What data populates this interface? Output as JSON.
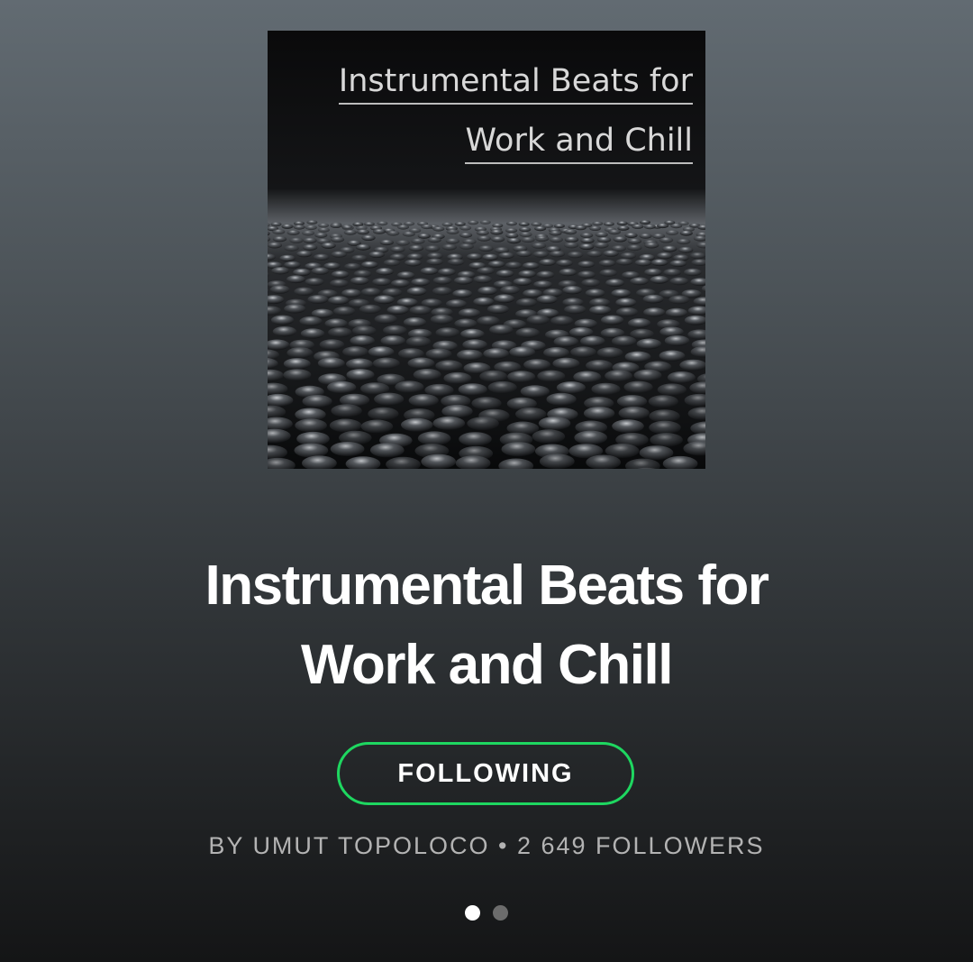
{
  "cover": {
    "line1": "Instrumental Beats for",
    "line2": "Work and Chill"
  },
  "playlist": {
    "title_line1": "Instrumental Beats for",
    "title_line2": "Work and Chill",
    "follow_label": "FOLLOWING",
    "by_label": "BY UMUT TOPOLOCO",
    "separator": "•",
    "followers_label": "2 649 FOLLOWERS"
  },
  "pager": {
    "pages": 2,
    "active_index": 0
  },
  "colors": {
    "accent": "#1ed760",
    "text_primary": "#ffffff",
    "text_secondary": "#b3b3b3"
  }
}
